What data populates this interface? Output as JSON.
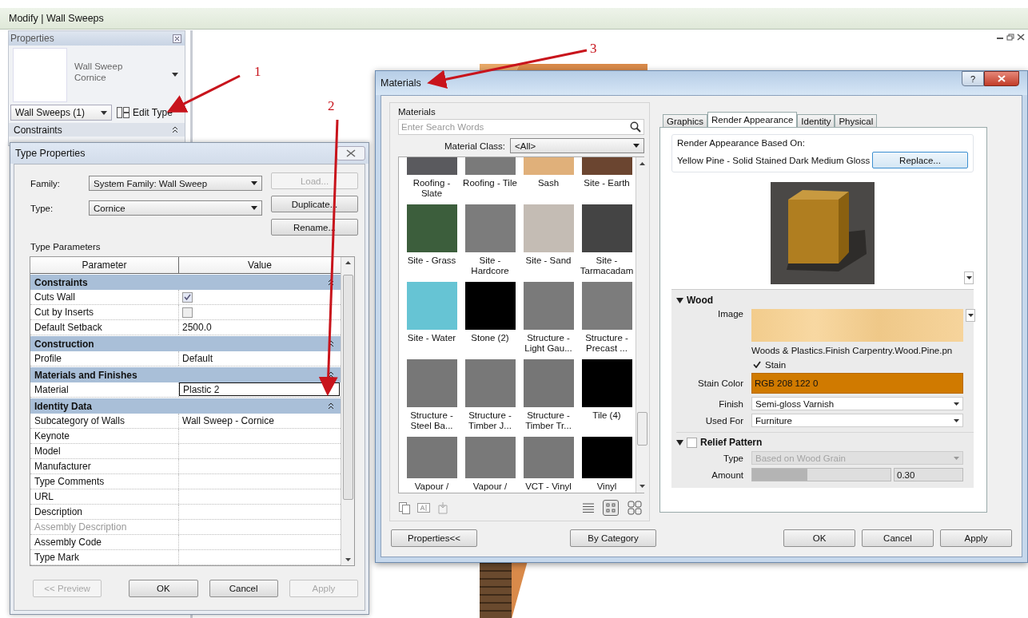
{
  "ribbon_title": "Modify | Wall Sweeps",
  "properties_palette": {
    "title": "Properties",
    "type_name": [
      "Wall Sweep",
      "Cornice"
    ],
    "selector": "Wall Sweeps (1)",
    "edit_type": "Edit Type",
    "section": "Constraints"
  },
  "annotations": [
    {
      "label": "1"
    },
    {
      "label": "2"
    },
    {
      "label": "3"
    }
  ],
  "type_properties": {
    "title": "Type Properties",
    "fields": [
      {
        "label": "Family:",
        "value": "System Family: Wall Sweep"
      },
      {
        "label": "Type:",
        "value": "Cornice"
      }
    ],
    "side_buttons": [
      {
        "label": "Load...",
        "disabled": true
      },
      {
        "label": "Duplicate...",
        "disabled": false
      },
      {
        "label": "Rename...",
        "disabled": false
      }
    ],
    "section_label": "Type Parameters",
    "columns": [
      "Parameter",
      "Value"
    ],
    "groups": [
      {
        "name": "Constraints",
        "expanded": true,
        "rows": [
          {
            "parameter": "Cuts Wall",
            "kind": "checkbox",
            "checked": true
          },
          {
            "parameter": "Cut by Inserts",
            "kind": "checkbox",
            "checked": false
          },
          {
            "parameter": "Default Setback",
            "kind": "text",
            "value": "2500.0"
          }
        ]
      },
      {
        "name": "Construction",
        "expanded": true,
        "rows": [
          {
            "parameter": "Profile",
            "kind": "text",
            "value": "Default"
          }
        ]
      },
      {
        "name": "Materials and Finishes",
        "expanded": true,
        "rows": [
          {
            "parameter": "Material",
            "kind": "text",
            "value": "Plastic 2",
            "selected": true
          }
        ]
      },
      {
        "name": "Identity Data",
        "expanded": true,
        "rows": [
          {
            "parameter": "Subcategory of Walls",
            "kind": "text",
            "value": "Wall Sweep - Cornice"
          },
          {
            "parameter": "Keynote",
            "kind": "text"
          },
          {
            "parameter": "Model",
            "kind": "text"
          },
          {
            "parameter": "Manufacturer",
            "kind": "text"
          },
          {
            "parameter": "Type Comments",
            "kind": "text"
          },
          {
            "parameter": "URL",
            "kind": "text"
          },
          {
            "parameter": "Description",
            "kind": "text"
          },
          {
            "parameter": "Assembly Description",
            "kind": "text",
            "disabled": true
          },
          {
            "parameter": "Assembly Code",
            "kind": "text"
          },
          {
            "parameter": "Type Mark",
            "kind": "text"
          }
        ]
      }
    ],
    "footer_buttons": [
      {
        "label": "<< Preview",
        "disabled": true
      },
      {
        "label": "OK",
        "disabled": false
      },
      {
        "label": "Cancel",
        "disabled": false
      },
      {
        "label": "Apply",
        "disabled": true
      }
    ]
  },
  "materials_dialog": {
    "title": "Materials",
    "help_button": "?",
    "list_label": "Materials",
    "search": {
      "placeholder": "Enter Search Words"
    },
    "class_label": "Material Class:",
    "class_value": "<All>",
    "tiles": [
      {
        "name": "Roofing - Slate",
        "color": "#5a5a5e"
      },
      {
        "name": "Roofing - Tile",
        "color": "#7a7a7a"
      },
      {
        "name": "Sash",
        "color": "#e0b07a"
      },
      {
        "name": "Site - Earth",
        "color": "#6b4530"
      },
      {
        "name": "Site - Grass",
        "color": "#3c5e3c"
      },
      {
        "name": "Site - Hardcore",
        "color": "#7c7c7c"
      },
      {
        "name": "Site - Sand",
        "color": "#c4bcb4"
      },
      {
        "name": "Site - Tarmacadam",
        "color": "#444444"
      },
      {
        "name": "Site - Water",
        "color": "#66c4d4"
      },
      {
        "name": "Stone (2)",
        "color": "#000000"
      },
      {
        "name": "Structure - Light Gau...",
        "color": "#7a7a7a"
      },
      {
        "name": "Structure - Precast ...",
        "color": "#7c7c7c"
      },
      {
        "name": "Structure - Steel Ba...",
        "color": "#777777"
      },
      {
        "name": "Structure - Timber J...",
        "color": "#787878"
      },
      {
        "name": "Structure - Timber Tr...",
        "color": "#767676"
      },
      {
        "name": "Tile (4)",
        "color": "#000000"
      },
      {
        "name": "Vapour /",
        "color": "#777777"
      },
      {
        "name": "Vapour /",
        "color": "#797979"
      },
      {
        "name": "VCT - Vinyl",
        "color": "#787878"
      },
      {
        "name": "Vinyl",
        "color": "#000000"
      }
    ],
    "view_modes": [
      {
        "kind": "list",
        "selected": false
      },
      {
        "kind": "small",
        "selected": true
      },
      {
        "kind": "large",
        "selected": false
      }
    ],
    "tabs": [
      {
        "label": "Graphics",
        "selected": false
      },
      {
        "label": "Render Appearance",
        "selected": true
      },
      {
        "label": "Identity",
        "selected": false
      },
      {
        "label": "Physical",
        "selected": false
      }
    ],
    "based_on_label": "Render Appearance Based On:",
    "based_on": "Yellow Pine - Solid Stained Dark Medium Gloss",
    "replace_button": "Replace...",
    "wood": {
      "title": "Wood",
      "expanded": true,
      "image_label": "Image",
      "image_file": "Woods & Plastics.Finish Carpentry.Wood.Pine.pn",
      "stain": {
        "label": "Stain",
        "checked": true
      },
      "stain_color_label": "Stain Color",
      "stain_color": "RGB 208 122 0",
      "finish_label": "Finish",
      "finish": "Semi-gloss Varnish",
      "used_for_label": "Used For",
      "used_for": "Furniture"
    },
    "relief": {
      "title": "Relief Pattern",
      "expanded": true,
      "checked": false,
      "type_label": "Type",
      "type": "Based on Wood Grain",
      "amount_label": "Amount",
      "level": 0.4,
      "amount": "0.30"
    },
    "left_buttons": [
      "Properties<<",
      "By Category"
    ],
    "buttons": [
      "OK",
      "Cancel",
      "Apply"
    ]
  }
}
